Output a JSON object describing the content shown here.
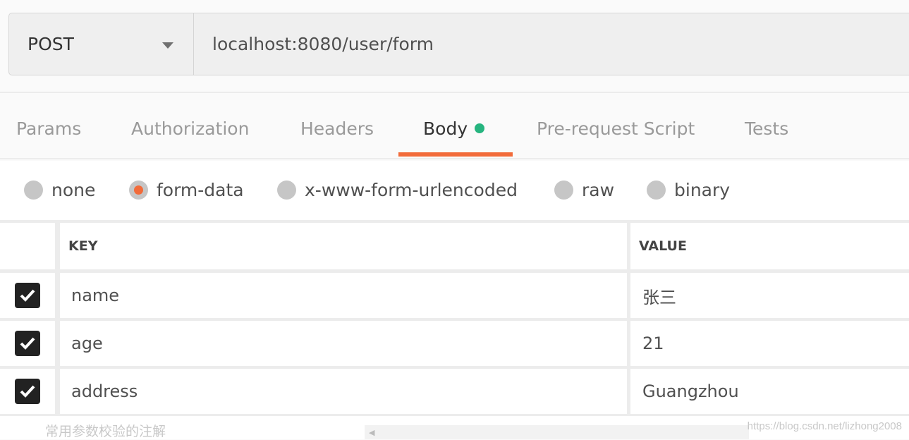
{
  "request": {
    "method": "POST",
    "url": "localhost:8080/user/form"
  },
  "tabs": [
    {
      "label": "Params"
    },
    {
      "label": "Authorization"
    },
    {
      "label": "Headers"
    },
    {
      "label": "Body",
      "active": true,
      "indicator_color": "#26b47f"
    },
    {
      "label": "Pre-request Script"
    },
    {
      "label": "Tests"
    }
  ],
  "body_types": [
    {
      "label": "none"
    },
    {
      "label": "form-data",
      "selected": true
    },
    {
      "label": "x-www-form-urlencoded"
    },
    {
      "label": "raw"
    },
    {
      "label": "binary"
    }
  ],
  "table": {
    "headers": {
      "key": "KEY",
      "value": "VALUE"
    },
    "rows": [
      {
        "checked": true,
        "key": "name",
        "value": "张三"
      },
      {
        "checked": true,
        "key": "age",
        "value": "21"
      },
      {
        "checked": true,
        "key": "address",
        "value": "Guangzhou"
      }
    ]
  },
  "footer": {
    "caption": "常用参数校验的注解",
    "watermark": "https://blog.csdn.net/lizhong2008"
  },
  "colors": {
    "accent": "#f26b3a",
    "success": "#26b47f"
  }
}
